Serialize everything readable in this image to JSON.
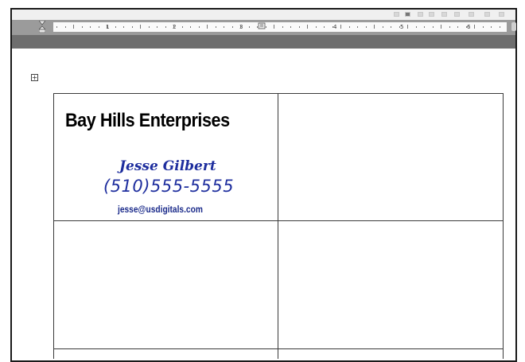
{
  "toolbar": {
    "icons": [
      "toolbar-button-icon"
    ]
  },
  "ruler": {
    "numbers": [
      "1",
      "2",
      "3",
      "4",
      "5",
      "6"
    ]
  },
  "table": {
    "move_handle_icon": "table-move-handle-icon",
    "card": {
      "company": "Bay Hills Enterprises",
      "name": "Jesse Gilbert",
      "phone": "(510)555-5555",
      "email": "jesse@usdigitals.com"
    }
  },
  "colors": {
    "card_text_blue": "#1e2e9e",
    "ruler_band": "#9b9b9b",
    "cell_border": "#3a3a3a"
  }
}
